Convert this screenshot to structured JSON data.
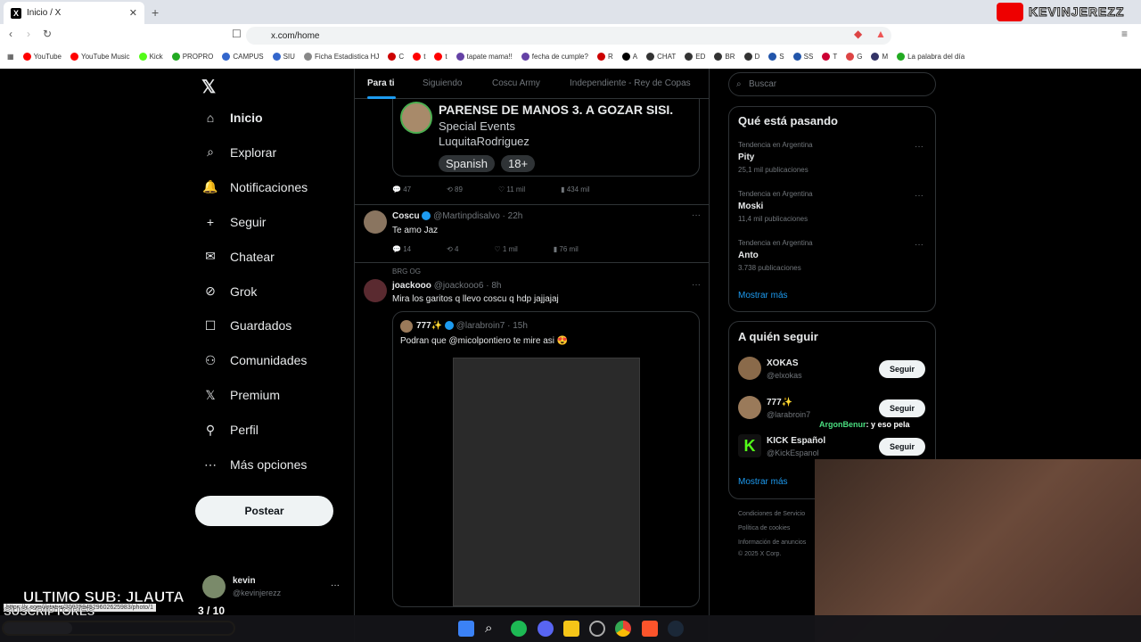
{
  "browser": {
    "tab_title": "Inicio / X",
    "url": "x.com/home",
    "bookmarks": [
      "YouTube",
      "YouTube Music",
      "Kick",
      "PROPRO",
      "CAMPUS",
      "SIU",
      "Ficha Estadistica HJ",
      "C",
      "t",
      "t",
      "tapate mama!!",
      "fecha de cumple?",
      "R",
      "A",
      "CHAT",
      "ED",
      "BR",
      "D",
      "S",
      "SS",
      "T",
      "G",
      "M",
      "La palabra del día"
    ],
    "status_url": "https://x.com/i/status/2002594529602625983/photo/1"
  },
  "stream_banner": "KEVINJEREZZ",
  "nav": {
    "items": [
      "Inicio",
      "Explorar",
      "Notificaciones",
      "Seguir",
      "Chatear",
      "Grok",
      "Guardados",
      "Comunidades",
      "Premium",
      "Perfil",
      "Más opciones"
    ],
    "post_button": "Postear",
    "user_name": "kevin",
    "user_handle": "@kevinjerezz"
  },
  "feed": {
    "tabs": [
      "Para ti",
      "Siguiendo",
      "Coscu Army",
      "Independiente - Rey de Copas"
    ],
    "post1": {
      "card_title": "PARENSE DE MANOS 3. A GOZAR SISI.",
      "card_sub1": "Special Events",
      "card_sub2": "LuquitaRodriguez",
      "tags": [
        "Spanish",
        "18+"
      ],
      "replies": "47",
      "reposts": "89",
      "likes": "11 mil",
      "views": "434 mil"
    },
    "post2": {
      "name": "Coscu",
      "handle": "@Martinpdisalvo · 22h",
      "text": "Te amo Jaz",
      "replies": "14",
      "reposts": "4",
      "likes": "1 mil",
      "views": "76 mil"
    },
    "post3": {
      "context": "BRG OG",
      "name": "joackooo",
      "handle": "@joackooo6 · 8h",
      "text": "Mira los garitos q llevo coscu q hdp jajjajaj",
      "quote_name": "777✨",
      "quote_handle": "@larabroin7 · 15h",
      "quote_text": "Podran que @micolpontiero te mire asi 😍"
    }
  },
  "right": {
    "search_placeholder": "Buscar",
    "trends_title": "Qué está pasando",
    "trends": [
      {
        "context": "Tendencia en Argentina",
        "name": "Pity",
        "count": "25,1 mil publicaciones"
      },
      {
        "context": "Tendencia en Argentina",
        "name": "Moski",
        "count": "11,4 mil publicaciones"
      },
      {
        "context": "Tendencia en Argentina",
        "name": "Anto",
        "count": "3.738 publicaciones"
      }
    ],
    "show_more": "Mostrar más",
    "follow_title": "A quién seguir",
    "follow": [
      {
        "name": "XOKAS",
        "handle": "@elxokas"
      },
      {
        "name": "777✨",
        "handle": "@larabroin7"
      },
      {
        "name": "KICK Español",
        "handle": "@KickEspanol"
      }
    ],
    "follow_label": "Seguir",
    "footer1": "Condiciones de Servicio",
    "footer2": "Política de cookies",
    "footer3": "Información de anuncios",
    "footer4": "© 2025 X Corp."
  },
  "stream": {
    "chat_user": "ArgonBenur",
    "chat_msg": ": y eso pela",
    "last_sub": "ULTIMO SUB: JLAUTA",
    "subs_label": "SUSCRIPTORES",
    "subs_count": "3 / 10",
    "subs_progress": 0.3
  },
  "colors": {
    "accent": "#1d9bf0",
    "bg": "#000000",
    "text": "#e7e9ea",
    "muted": "#71767b"
  }
}
